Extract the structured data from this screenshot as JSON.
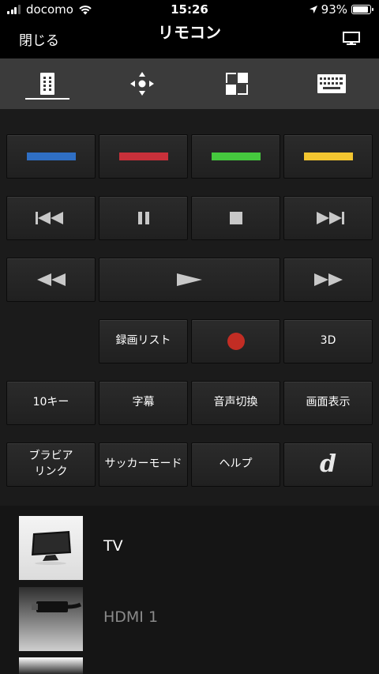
{
  "status_bar": {
    "carrier": "docomo",
    "time": "15:26",
    "battery": "93%",
    "battery_level": 0.93
  },
  "nav": {
    "close_label": "閉じる",
    "title": "リモコン"
  },
  "tabs": [
    {
      "icon": "remote-icon",
      "selected": true
    },
    {
      "icon": "dpad-icon",
      "selected": false
    },
    {
      "icon": "grid-icon",
      "selected": false
    },
    {
      "icon": "keyboard-icon",
      "selected": false
    }
  ],
  "colors": {
    "blue": "#2f6fc4",
    "red": "#c8303a",
    "green": "#45c83e",
    "yellow": "#f2c530",
    "record": "#c22d24"
  },
  "buttons": {
    "rec_list": "録画リスト",
    "three_d": "3D",
    "ten_key": "10キー",
    "subtitles": "字幕",
    "audio_switch": "音声切換",
    "screen_display": "画面表示",
    "bravia_link_line1": "ブラビア",
    "bravia_link_line2": "リンク",
    "soccer_mode": "サッカーモード",
    "help": "ヘルプ",
    "d_button": "d"
  },
  "sources": [
    {
      "label": "TV",
      "icon": "tv-thumbnail",
      "active": true
    },
    {
      "label": "HDMI 1",
      "icon": "hdmi-cable-thumbnail",
      "active": false
    }
  ]
}
